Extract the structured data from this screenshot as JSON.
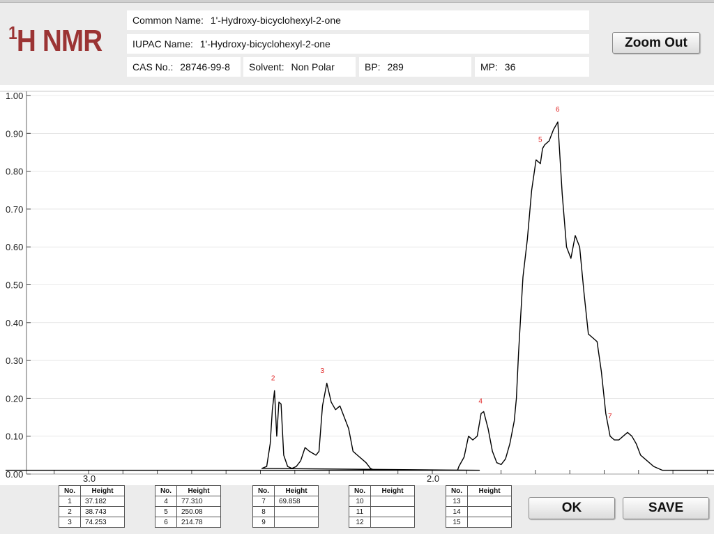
{
  "header": {
    "logo_sup": "1",
    "logo_text": "H NMR",
    "common_name_label": "Common Name:",
    "common_name_value": "1'-Hydroxy-bicyclohexyl-2-one",
    "iupac_name_label": "IUPAC Name:",
    "iupac_name_value": "1'-Hydroxy-bicyclohexyl-2-one",
    "cas_label": "CAS No.:",
    "cas_value": "28746-99-8",
    "solvent_label": "Solvent:",
    "solvent_value": "Non Polar",
    "bp_label": "BP:",
    "bp_value": "289",
    "mp_label": "MP:",
    "mp_value": "36"
  },
  "buttons": {
    "zoom_out": "Zoom Out",
    "ok": "OK",
    "save": "SAVE"
  },
  "peak_tables": [
    {
      "col_no": "No.",
      "col_height": "Height",
      "rows": [
        [
          "1",
          "37.182"
        ],
        [
          "2",
          "38.743"
        ],
        [
          "3",
          "74.253"
        ]
      ]
    },
    {
      "col_no": "No.",
      "col_height": "Height",
      "rows": [
        [
          "4",
          "77.310"
        ],
        [
          "5",
          "250.08"
        ],
        [
          "6",
          "214.78"
        ]
      ]
    },
    {
      "col_no": "No.",
      "col_height": "Height",
      "rows": [
        [
          "7",
          "69.858"
        ],
        [
          "8",
          ""
        ],
        [
          "9",
          ""
        ]
      ]
    },
    {
      "col_no": "No.",
      "col_height": "Height",
      "rows": [
        [
          "10",
          ""
        ],
        [
          "11",
          ""
        ],
        [
          "12",
          ""
        ]
      ]
    },
    {
      "col_no": "No.",
      "col_height": "Height",
      "rows": [
        [
          "13",
          ""
        ],
        [
          "14",
          ""
        ],
        [
          "15",
          ""
        ]
      ]
    }
  ],
  "colors": {
    "logo": "#9b3434",
    "trace": "#000000",
    "peak_label": "#e02020"
  },
  "chart_data": {
    "type": "line",
    "title": "",
    "xlabel": "",
    "ylabel": "",
    "x_reversed": true,
    "xlim": [
      3.2,
      1.18
    ],
    "ylim": [
      0,
      1.0
    ],
    "y_ticks": [
      "1.00",
      "0.90",
      "0.80",
      "0.70",
      "0.60",
      "0.50",
      "0.40",
      "0.30",
      "0.20",
      "0.10",
      "0.00"
    ],
    "y_tick_values": [
      1.0,
      0.9,
      0.8,
      0.7,
      0.6,
      0.5,
      0.4,
      0.3,
      0.2,
      0.1,
      0.0
    ],
    "x_labels": [
      "3.0",
      "2.0"
    ],
    "x_label_values": [
      3.0,
      2.0
    ],
    "x_minor_ticks": [
      3.1,
      3.0,
      2.9,
      2.8,
      2.7,
      2.6,
      2.5,
      2.4,
      2.3,
      2.2,
      2.1,
      2.0,
      1.9,
      1.8,
      1.7,
      1.6,
      1.5,
      1.4,
      1.3,
      1.2
    ],
    "grid": false,
    "series": [
      {
        "x": [
          3.2,
          2.7,
          2.701,
          2.712,
          2.72,
          2.725,
          2.73,
          2.735,
          2.74,
          2.745,
          2.751,
          2.76,
          2.77,
          2.78,
          2.79,
          2.8,
          2.81,
          2.825,
          2.832,
          2.84,
          2.85,
          2.86,
          2.87,
          2.88,
          2.89,
          2.9,
          2.91,
          2.92,
          2.93,
          2.94,
          2.95,
          2.96,
          2.97,
          2.99,
          3.002,
          3.008,
          3.016,
          3.03,
          3.1,
          3.15,
          3.153,
          3.165,
          3.175,
          3.185,
          3.195,
          3.204,
          3.21,
          3.22,
          3.23,
          3.24,
          3.25,
          3.26,
          3.27,
          3.28,
          3.285,
          3.29,
          3.3,
          3.31,
          3.32,
          3.33,
          3.34,
          3.345,
          3.35,
          3.36,
          3.37,
          3.38,
          3.39,
          3.4,
          3.41,
          3.42,
          3.43,
          3.44,
          3.45,
          3.46,
          3.47,
          3.48,
          3.49,
          3.5,
          3.51,
          3.52,
          3.53,
          3.54,
          3.55,
          3.56,
          3.57,
          3.58,
          3.6,
          3.62,
          3.65,
          3.7
        ],
        "y": [
          0.01,
          0.01,
          0.015,
          0.02,
          0.08,
          0.17,
          0.22,
          0.1,
          0.19,
          0.185,
          0.05,
          0.02,
          0.015,
          0.02,
          0.035,
          0.07,
          0.06,
          0.05,
          0.06,
          0.18,
          0.24,
          0.19,
          0.17,
          0.18,
          0.15,
          0.12,
          0.06,
          0.05,
          0.04,
          0.03,
          0.015,
          0.01,
          0.01,
          0.01,
          0.01,
          0.01,
          0.01,
          0.01,
          0.01,
          0.01,
          0.02,
          0.045,
          0.1,
          0.09,
          0.1,
          0.16,
          0.165,
          0.12,
          0.06,
          0.03,
          0.025,
          0.04,
          0.08,
          0.14,
          0.2,
          0.32,
          0.52,
          0.62,
          0.75,
          0.83,
          0.82,
          0.86,
          0.87,
          0.88,
          0.91,
          0.93,
          0.74,
          0.6,
          0.57,
          0.63,
          0.6,
          0.48,
          0.37,
          0.36,
          0.35,
          0.27,
          0.16,
          0.1,
          0.09,
          0.09,
          0.1,
          0.11,
          0.1,
          0.08,
          0.05,
          0.04,
          0.02,
          0.01,
          0.01,
          0.01
        ]
      }
    ],
    "peak_labels": [
      {
        "label": "2",
        "x": 2.727,
        "y": 0.24
      },
      {
        "label": "3",
        "x": 2.84,
        "y": 0.26
      },
      {
        "label": "4",
        "x": 3.203,
        "y": 0.18
      },
      {
        "label": "5",
        "x": 3.34,
        "y": 0.87
      },
      {
        "label": "6",
        "x": 3.38,
        "y": 0.95
      },
      {
        "label": "7",
        "x": 3.5,
        "y": 0.14
      }
    ]
  }
}
